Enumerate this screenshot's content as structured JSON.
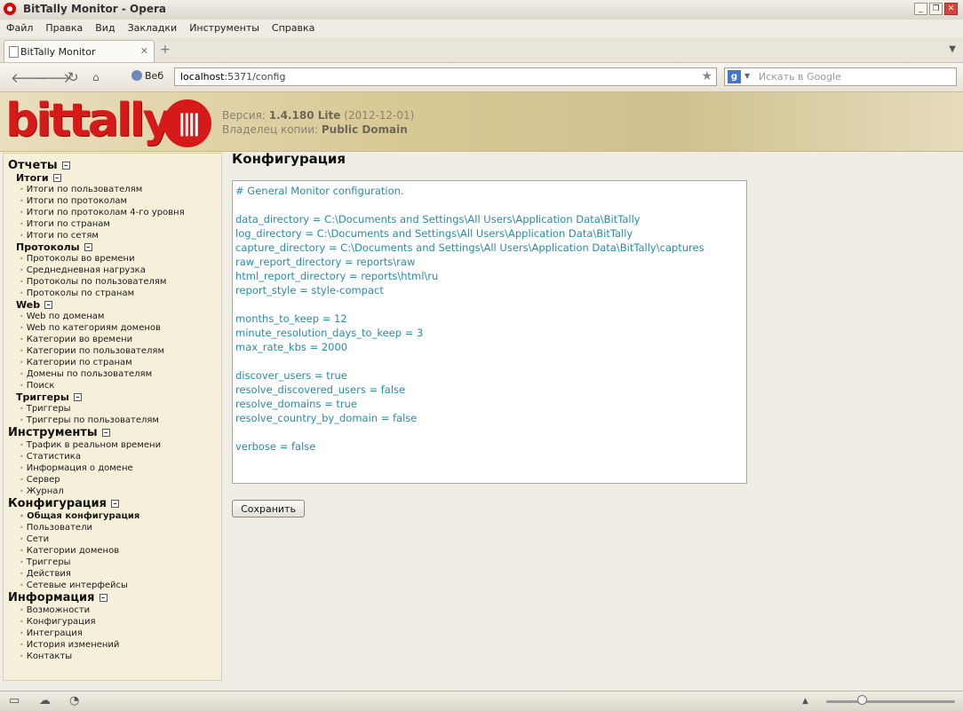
{
  "window": {
    "title": "BitTally Monitor - Opera"
  },
  "menu": [
    "Файл",
    "Правка",
    "Вид",
    "Закладки",
    "Инструменты",
    "Справка"
  ],
  "tab": {
    "label": "BitTally Monitor"
  },
  "navbar": {
    "web_label": "Веб",
    "url_host": "localhost",
    "url_rest": ":5371/config",
    "search_placeholder": "Искать в Google"
  },
  "header": {
    "logo_text": "bittally",
    "version_label": "Версия:",
    "version_value": "1.4.180 Lite",
    "version_date": "(2012-12-01)",
    "owner_label": "Владелец копии:",
    "owner_value": "Public Domain"
  },
  "sidebar": {
    "reports": {
      "label": "Отчеты",
      "totals": {
        "label": "Итоги",
        "items": [
          "Итоги по пользователям",
          "Итоги по протоколам",
          "Итоги по протоколам 4-го уровня",
          "Итоги по странам",
          "Итоги по сетям"
        ]
      },
      "protocols": {
        "label": "Протоколы",
        "items": [
          "Протоколы во времени",
          "Среднедневная нагрузка",
          "Протоколы по пользователям",
          "Протоколы по странам"
        ]
      },
      "web": {
        "label": "Web",
        "items": [
          "Web по доменам",
          "Web по категориям доменов",
          "Категории во времени",
          "Категории по пользователям",
          "Категории по странам",
          "Домены по пользователям",
          "Поиск"
        ]
      },
      "triggers": {
        "label": "Триггеры",
        "items": [
          "Триггеры",
          "Триггеры по пользователям"
        ]
      }
    },
    "tools": {
      "label": "Инструменты",
      "items": [
        "Трафик в реальном времени",
        "Статистика",
        "Информация о домене",
        "Сервер",
        "Журнал"
      ]
    },
    "config": {
      "label": "Конфигурация",
      "items": [
        "Общая конфигурация",
        "Пользователи",
        "Сети",
        "Категории доменов",
        "Триггеры",
        "Действия",
        "Сетевые интерфейсы"
      ]
    },
    "info": {
      "label": "Информация",
      "items": [
        "Возможности",
        "Конфигурация",
        "Интеграция",
        "История изменений",
        "Контакты"
      ]
    }
  },
  "main": {
    "title": "Конфигурация",
    "config_text": "# General Monitor configuration.\n\ndata_directory = C:\\Documents and Settings\\All Users\\Application Data\\BitTally\nlog_directory = C:\\Documents and Settings\\All Users\\Application Data\\BitTally\ncapture_directory = C:\\Documents and Settings\\All Users\\Application Data\\BitTally\\captures\nraw_report_directory = reports\\raw\nhtml_report_directory = reports\\html\\ru\nreport_style = style-compact\n\nmonths_to_keep = 12\nminute_resolution_days_to_keep = 3\nmax_rate_kbs = 2000\n\ndiscover_users = true\nresolve_discovered_users = false\nresolve_domains = true\nresolve_country_by_domain = false\n\nverbose = false",
    "save_label": "Сохранить"
  },
  "colors": {
    "brand_red": "#d61a1a",
    "config_text": "#2a8ba8"
  }
}
